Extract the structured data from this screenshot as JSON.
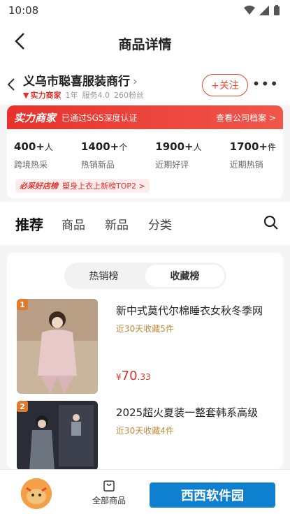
{
  "status": {
    "time": "10:08"
  },
  "header": {
    "title": "商品详情"
  },
  "shop": {
    "name": "义乌市聪喜服装商行",
    "badge": "实力商家",
    "years": "1年",
    "service": "服务4.0",
    "fans": "260粉丝",
    "follow_label": "+关注"
  },
  "card": {
    "badge": "实力商家",
    "cert": "已通过SGS深度认证",
    "archive": "查看公司档案 >",
    "stats": [
      {
        "num": "400+",
        "unit": "人",
        "label": "跨境热采"
      },
      {
        "num": "1400+",
        "unit": "个",
        "label": "热销新品"
      },
      {
        "num": "1900+",
        "unit": "人",
        "label": "近期好评"
      },
      {
        "num": "1700+",
        "unit": "件",
        "label": "近期热销"
      }
    ],
    "rank_tag": "必采好店榜",
    "rank_text": "塑身上衣上新榜TOP2 >"
  },
  "tabs": [
    "推荐",
    "商品",
    "新品",
    "分类"
  ],
  "segment": {
    "left": "热销榜",
    "right": "收藏榜"
  },
  "products": [
    {
      "rank": "1",
      "title": "新中式莫代尔棉睡衣女秋冬季网",
      "sub": "近30天收藏5件",
      "price_yen": "¥",
      "price_int": "70",
      "price_dec": ".33"
    },
    {
      "rank": "2",
      "title": "2025超火夏装一整套韩系高级",
      "sub": "近30天收藏4件",
      "price_yen": "",
      "price_int": "",
      "price_dec": ""
    }
  ],
  "bottom": {
    "all_goods": "全部商品",
    "watermark": "西西软件园"
  }
}
